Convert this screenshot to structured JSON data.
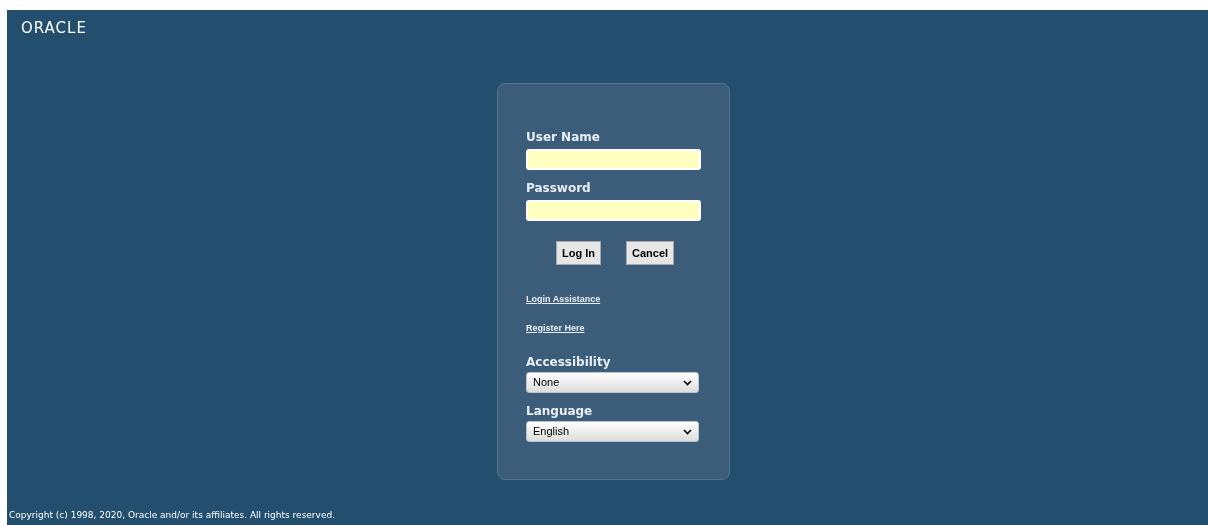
{
  "logo": "ORACLE",
  "login_form": {
    "fields": [
      {
        "label": "User Name"
      },
      {
        "label": "Password"
      }
    ],
    "buttons": [
      "Log In",
      "Cancel"
    ],
    "links": [
      "Login Assistance",
      "Register Here"
    ],
    "selects": [
      {
        "label": "Accessibility",
        "value": "None"
      },
      {
        "label": "Language",
        "value": "English"
      }
    ]
  },
  "footer": "Copyright (c) 1998, 2020, Oracle and/or its affiliates. All rights reserved."
}
